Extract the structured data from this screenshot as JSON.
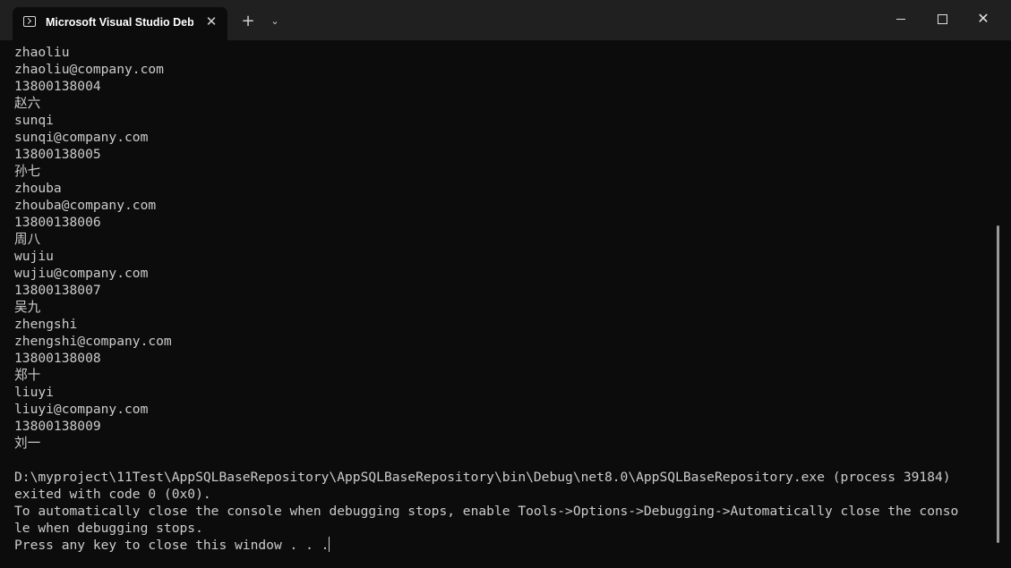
{
  "window": {
    "tab_title": "Microsoft Visual Studio Debug Console",
    "close_tab_glyph": "✕",
    "new_tab_glyph": "+",
    "dropdown_glyph": "⌄",
    "close_window_glyph": "✕"
  },
  "icons": {
    "tab": "terminal-icon",
    "new_tab": "plus-icon",
    "dropdown": "chevron-down-icon",
    "minimize": "minimize-icon",
    "maximize": "maximize-icon",
    "close": "close-icon"
  },
  "colors": {
    "console_bg": "#0c0c0c",
    "console_text": "#cccccc",
    "titlebar_bg": "#202020"
  },
  "console": {
    "lines": [
      "zhaoliu",
      "zhaoliu@company.com",
      "13800138004",
      "赵六",
      "sunqi",
      "sunqi@company.com",
      "13800138005",
      "孙七",
      "zhouba",
      "zhouba@company.com",
      "13800138006",
      "周八",
      "wujiu",
      "wujiu@company.com",
      "13800138007",
      "吴九",
      "zhengshi",
      "zhengshi@company.com",
      "13800138008",
      "郑十",
      "liuyi",
      "liuyi@company.com",
      "13800138009",
      "刘一",
      "",
      "D:\\myproject\\11Test\\AppSQLBaseRepository\\AppSQLBaseRepository\\bin\\Debug\\net8.0\\AppSQLBaseRepository.exe (process 39184)",
      "exited with code 0 (0x0).",
      "To automatically close the console when debugging stops, enable Tools->Options->Debugging->Automatically close the conso",
      "le when debugging stops.",
      "Press any key to close this window . . ."
    ]
  }
}
